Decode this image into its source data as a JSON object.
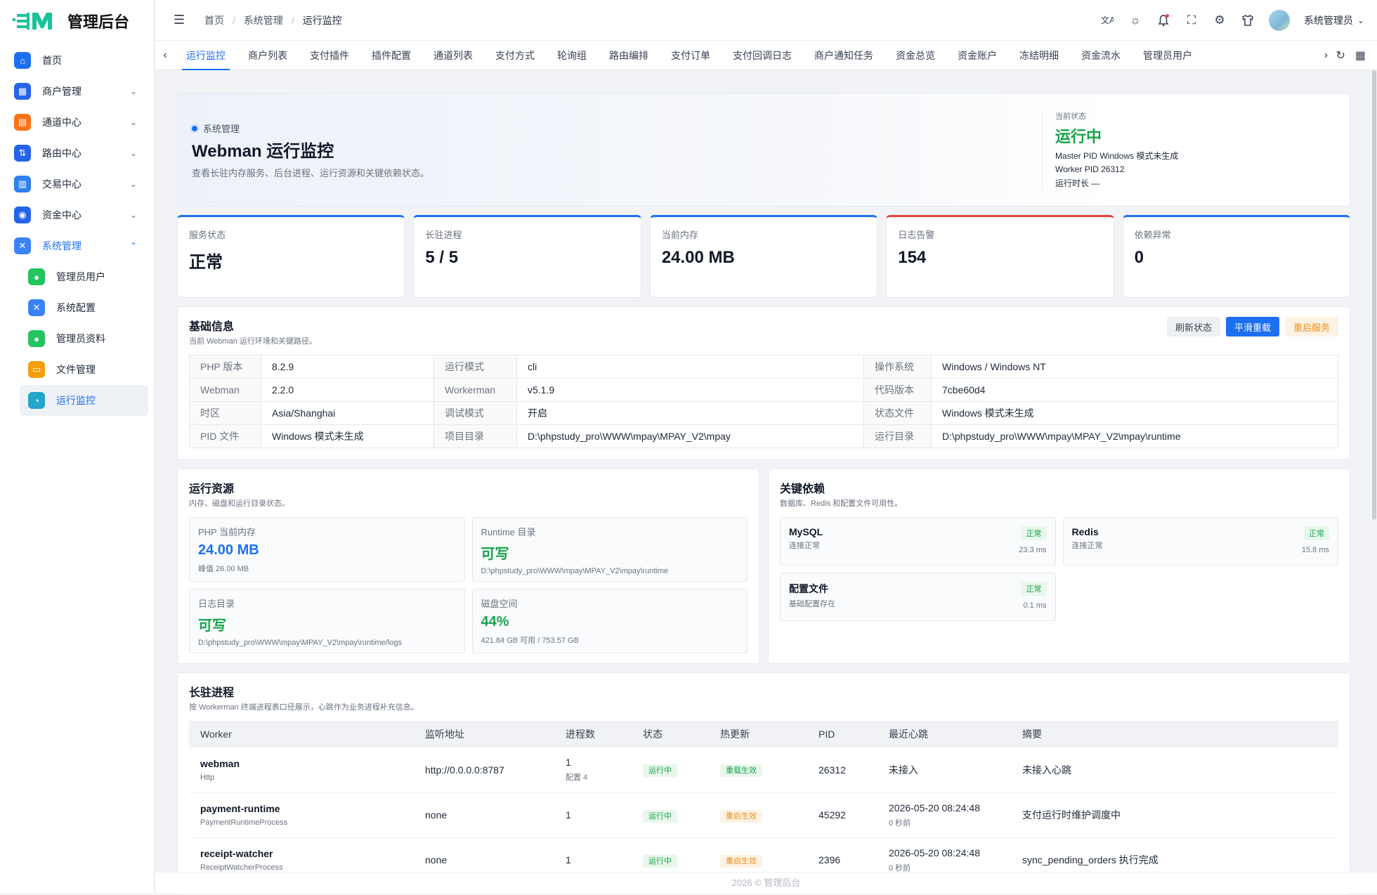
{
  "app": {
    "title": "管理后台"
  },
  "sidebar": {
    "items": [
      {
        "label": "首页",
        "icon": "home-icon",
        "color": "#1d6ff2",
        "glyph": "⌂"
      },
      {
        "label": "商户管理",
        "icon": "grid-icon",
        "color": "#2563eb",
        "glyph": "▦"
      },
      {
        "label": "通道中心",
        "icon": "channel-icon",
        "color": "#f97316",
        "glyph": "▤"
      },
      {
        "label": "路由中心",
        "icon": "route-icon",
        "color": "#2563eb",
        "glyph": "⇅"
      },
      {
        "label": "交易中心",
        "icon": "clipboard-icon",
        "color": "#2f80ed",
        "glyph": "▥"
      },
      {
        "label": "资金中心",
        "icon": "wallet-icon",
        "color": "#2563eb",
        "glyph": "◉"
      },
      {
        "label": "系统管理",
        "icon": "tools-icon",
        "color": "#3b82f6",
        "glyph": "✕"
      }
    ],
    "sub_items": [
      {
        "label": "管理员用户",
        "icon": "user-icon",
        "color": "#22c55e",
        "glyph": "●"
      },
      {
        "label": "系统配置",
        "icon": "tools-icon",
        "color": "#3b82f6",
        "glyph": "✕"
      },
      {
        "label": "管理员资料",
        "icon": "user-icon",
        "color": "#22c55e",
        "glyph": "●"
      },
      {
        "label": "文件管理",
        "icon": "folder-icon",
        "color": "#f59e0b",
        "glyph": "▭"
      },
      {
        "label": "运行监控",
        "icon": "monitor-icon",
        "color": "#22a7c9",
        "glyph": "◔"
      }
    ]
  },
  "header": {
    "breadcrumb": [
      "首页",
      "系统管理",
      "运行监控"
    ],
    "user_name": "系统管理员"
  },
  "tabs": [
    "运行监控",
    "商户列表",
    "支付插件",
    "插件配置",
    "通道列表",
    "支付方式",
    "轮询组",
    "路由编排",
    "支付订单",
    "支付回调日志",
    "商户通知任务",
    "资金总览",
    "资金账户",
    "冻结明细",
    "资金流水",
    "管理员用户"
  ],
  "hero": {
    "tag": "系统管理",
    "title": "Webman 运行监控",
    "desc": "查看长驻内存服务、后台进程、运行资源和关键依赖状态。",
    "status_label": "当前状态",
    "status": "运行中",
    "master_pid": "Master PID Windows 模式未生成",
    "worker_pid": "Worker PID 26312",
    "uptime": "运行时长 —"
  },
  "kpis": [
    {
      "label": "服务状态",
      "value": "正常"
    },
    {
      "label": "长驻进程",
      "value": "5 / 5"
    },
    {
      "label": "当前内存",
      "value": "24.00 MB"
    },
    {
      "label": "日志告警",
      "value": "154"
    },
    {
      "label": "依赖异常",
      "value": "0"
    }
  ],
  "basic": {
    "title": "基础信息",
    "sub": "当前 Webman 运行环境和关键路径。",
    "btn_refresh": "刷新状态",
    "btn_reload": "平滑重载",
    "btn_restart": "重启服务",
    "rows": [
      [
        {
          "k": "PHP 版本",
          "v": "8.2.9"
        },
        {
          "k": "运行模式",
          "v": "cli"
        },
        {
          "k": "操作系统",
          "v": "Windows / Windows NT"
        }
      ],
      [
        {
          "k": "Webman",
          "v": "2.2.0"
        },
        {
          "k": "Workerman",
          "v": "v5.1.9"
        },
        {
          "k": "代码版本",
          "v": "7cbe60d4"
        }
      ],
      [
        {
          "k": "时区",
          "v": "Asia/Shanghai"
        },
        {
          "k": "调试模式",
          "v": "开启"
        },
        {
          "k": "状态文件",
          "v": "Windows 模式未生成"
        }
      ],
      [
        {
          "k": "PID 文件",
          "v": "Windows 模式未生成"
        },
        {
          "k": "项目目录",
          "v": "D:\\phpstudy_pro\\WWW\\mpay\\MPAY_V2\\mpay"
        },
        {
          "k": "运行目录",
          "v": "D:\\phpstudy_pro\\WWW\\mpay\\MPAY_V2\\mpay\\runtime"
        }
      ]
    ]
  },
  "resources": {
    "title": "运行资源",
    "sub": "内存、磁盘和运行目录状态。",
    "cards": [
      {
        "label": "PHP 当前内存",
        "value": "24.00 MB",
        "tone": "blue",
        "sub": "峰值 26.00 MB"
      },
      {
        "label": "Runtime 目录",
        "value": "可写",
        "tone": "green",
        "sub": "D:\\phpstudy_pro\\WWW\\mpay\\MPAY_V2\\mpay\\runtime"
      },
      {
        "label": "日志目录",
        "value": "可写",
        "tone": "green",
        "sub": "D:\\phpstudy_pro\\WWW\\mpay\\MPAY_V2\\mpay\\runtime/logs"
      },
      {
        "label": "磁盘空间",
        "value": "44%",
        "tone": "green",
        "sub": "421.84 GB 可用 / 753.57 GB"
      }
    ]
  },
  "deps": {
    "title": "关键依赖",
    "sub": "数据库、Redis 和配置文件可用性。",
    "cards": [
      {
        "name": "MySQL",
        "desc": "连接正常",
        "badge": "正常",
        "ms": "23.3 ms"
      },
      {
        "name": "Redis",
        "desc": "连接正常",
        "badge": "正常",
        "ms": "15.8 ms"
      },
      {
        "name": "配置文件",
        "desc": "基础配置存在",
        "badge": "正常",
        "ms": "0.1 ms"
      }
    ]
  },
  "procs": {
    "title": "长驻进程",
    "sub": "按 Workerman 终端进程表口径展示，心跳作为业务进程补充信息。",
    "headers": [
      "Worker",
      "监听地址",
      "进程数",
      "状态",
      "热更新",
      "PID",
      "最近心跳",
      "摘要"
    ],
    "rows": [
      {
        "name": "webman",
        "class": "Http",
        "listen": "http://0.0.0.0:8787",
        "count": "1",
        "count_sub": "配置 4",
        "status": "运行中",
        "hot": "重载生效",
        "hot_tone": "green",
        "pid": "26312",
        "beat": "未接入",
        "beat_sub": "",
        "summary": "未接入心跳"
      },
      {
        "name": "payment-runtime",
        "class": "PaymentRuntimeProcess",
        "listen": "none",
        "count": "1",
        "count_sub": "",
        "status": "运行中",
        "hot": "重启生效",
        "hot_tone": "orange",
        "pid": "45292",
        "beat": "2026-05-20 08:24:48",
        "beat_sub": "0 秒前",
        "summary": "支付运行时维护调度中"
      },
      {
        "name": "receipt-watcher",
        "class": "ReceiptWatcherProcess",
        "listen": "none",
        "count": "1",
        "count_sub": "",
        "status": "运行中",
        "hot": "重启生效",
        "hot_tone": "orange",
        "pid": "2396",
        "beat": "2026-05-20 08:24:48",
        "beat_sub": "0 秒前",
        "summary": "sync_pending_orders 执行完成"
      }
    ]
  },
  "footer": "2026 © 管理后台"
}
